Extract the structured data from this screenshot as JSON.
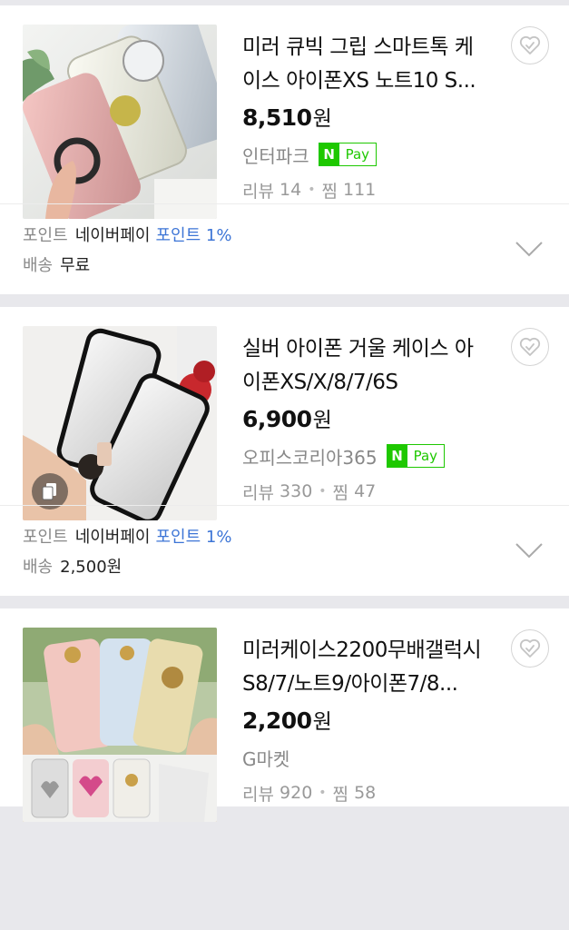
{
  "products": [
    {
      "title": "미러 큐빅 그립 스마트톡 케이스 아이폰XS 노트10 S...",
      "price": "8,510",
      "currency": "원",
      "seller": "인터파크",
      "npay": true,
      "review_label": "리뷰",
      "review_count": "14",
      "zzim_label": "찜",
      "zzim_count": "111",
      "point_label": "포인트",
      "point_source": "네이버페이",
      "point_value": "포인트 1%",
      "shipping_label": "배송",
      "shipping_value": "무료"
    },
    {
      "title": "실버 아이폰 거울 케이스 아이폰XS/X/8/7/6S",
      "price": "6,900",
      "currency": "원",
      "seller": "오피스코리아365",
      "npay": true,
      "review_label": "리뷰",
      "review_count": "330",
      "zzim_label": "찜",
      "zzim_count": "47",
      "point_label": "포인트",
      "point_source": "네이버페이",
      "point_value": "포인트 1%",
      "shipping_label": "배송",
      "shipping_value": "2,500원"
    },
    {
      "title": "미러케이스2200무배갤럭시S8/7/노트9/아이폰7/8...",
      "price": "2,200",
      "currency": "원",
      "seller": "G마켓",
      "npay": false,
      "review_label": "리뷰",
      "review_count": "920",
      "zzim_label": "찜",
      "zzim_count": "58"
    }
  ],
  "npay_badge": {
    "n": "N",
    "label": "Pay"
  },
  "colors": {
    "npay_green": "#1ec800",
    "point_blue": "#3d75d6"
  },
  "icons": {
    "wishlist": "heart-check-icon",
    "expand": "chevron-down-icon",
    "multi_image": "copy-icon"
  }
}
